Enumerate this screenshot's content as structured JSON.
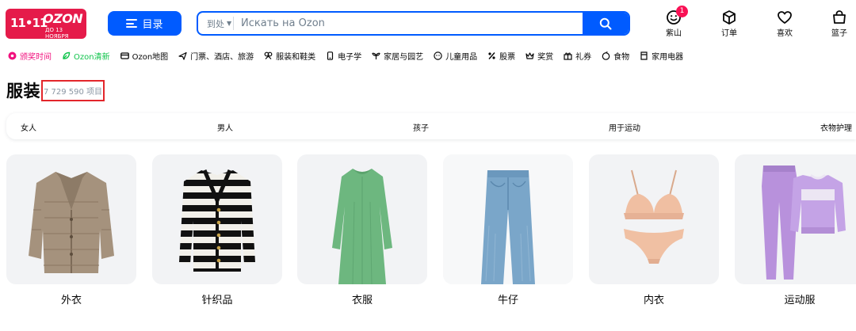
{
  "header": {
    "logo": {
      "sale_text": "11•11",
      "brand": "OZON",
      "date_text": "ДО 13 НОЯБРЯ",
      "color": "#e51b4a"
    },
    "catalog_label": "目录",
    "search": {
      "where_label": "到处",
      "placeholder": "Искать на Ozon"
    },
    "actions": [
      {
        "label": "紫山",
        "icon": "face-icon",
        "badge": "1"
      },
      {
        "label": "订单",
        "icon": "box-icon"
      },
      {
        "label": "喜欢",
        "icon": "heart-icon"
      },
      {
        "label": "篮子",
        "icon": "basket-icon"
      }
    ],
    "accent": "#005bff"
  },
  "quick_links": [
    {
      "label": "颁奖时间",
      "icon": "award-icon",
      "color": "#f1117e"
    },
    {
      "label": "Ozon清新",
      "icon": "leaf-icon",
      "color": "#10c44c"
    },
    {
      "label": "Ozon地图",
      "icon": "card-icon"
    },
    {
      "label": "门票、酒店、旅游",
      "icon": "plane-icon"
    },
    {
      "label": "服装和鞋类",
      "icon": "clothes-icon"
    },
    {
      "label": "电子学",
      "icon": "phone-icon"
    },
    {
      "label": "家居与园艺",
      "icon": "plant-icon"
    },
    {
      "label": "儿童用品",
      "icon": "child-icon"
    },
    {
      "label": "股票",
      "icon": "percent-icon"
    },
    {
      "label": "奖赏",
      "icon": "crown-icon"
    },
    {
      "label": "礼券",
      "icon": "gift-icon"
    },
    {
      "label": "食物",
      "icon": "food-icon"
    },
    {
      "label": "家用电器",
      "icon": "appliance-icon"
    }
  ],
  "page": {
    "title": "服装",
    "item_count": "7 729 590 项目"
  },
  "subcategories": [
    "女人",
    "男人",
    "孩子",
    "用于运动",
    "衣物护理"
  ],
  "categories": [
    {
      "name": "外衣",
      "icon": "jacket-icon"
    },
    {
      "name": "针织品",
      "icon": "cardigan-icon"
    },
    {
      "name": "衣服",
      "icon": "dress-icon"
    },
    {
      "name": "牛仔",
      "icon": "jeans-icon"
    },
    {
      "name": "内衣",
      "icon": "lingerie-icon"
    },
    {
      "name": "运动服",
      "icon": "tracksuit-icon"
    }
  ]
}
